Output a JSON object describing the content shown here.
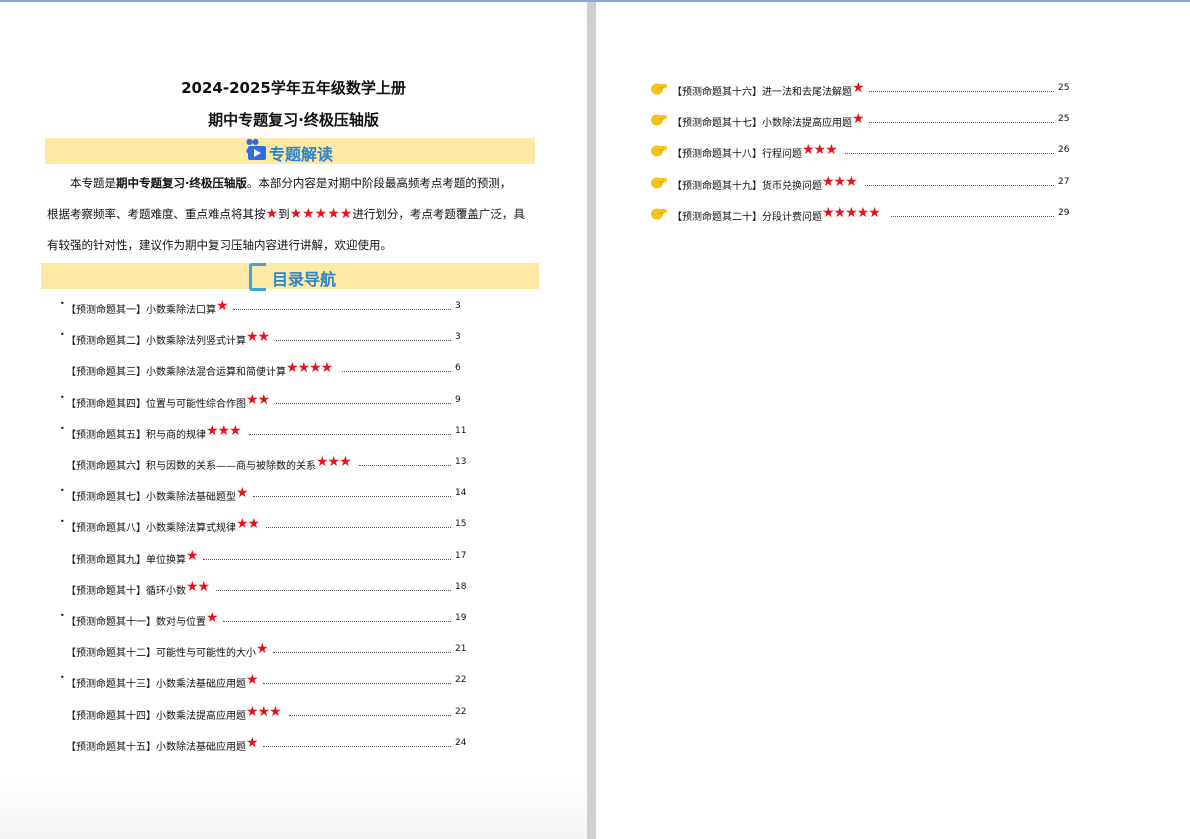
{
  "document": {
    "title_line1": "2024-2025学年五年级数学上册",
    "title_line2": "期中专题复习·终极压轴版",
    "section1_label": "专题解读",
    "section2_label": "目录导航",
    "intro": {
      "line1_pre": "本专题是",
      "line1_bold": "期中专题复习·终极压轴版",
      "line1_post": "。本部分内容是对期中阶段最高频考点考题的预测，",
      "line2_pre": "根据考察频率、考题难度、重点难点将其按",
      "line2_star1": "★",
      "line2_mid": "到",
      "line2_star5": "★★★★★",
      "line2_post": "进行划分，考点考题覆盖广泛，具",
      "line3": "有较强的针对性，建议作为期中复习压轴内容进行讲解，欢迎使用。"
    }
  },
  "toc_left": [
    {
      "label": "【预测命题其一】小数乘除法口算",
      "stars": "★",
      "page": "3"
    },
    {
      "label": "【预测命题其二】小数乘除法列竖式计算",
      "stars": "★★",
      "page": "3"
    },
    {
      "label": "【预测命题其三】小数乘除法混合运算和简便计算",
      "stars": "★★★★",
      "page": "6"
    },
    {
      "label": "【预测命题其四】位置与可能性综合作图",
      "stars": "★★",
      "page": "9"
    },
    {
      "label": "【预测命题其五】积与商的规律",
      "stars": "★★★",
      "page": "11"
    },
    {
      "label": "【预测命题其六】积与因数的关系——商与被除数的关系",
      "stars": "★★★",
      "page": "13"
    },
    {
      "label": "【预测命题其七】小数乘除法基础题型",
      "stars": "★",
      "page": "14"
    },
    {
      "label": "【预测命题其八】小数乘除法算式规律",
      "stars": "★★",
      "page": "15"
    },
    {
      "label": "【预测命题其九】单位换算",
      "stars": "★",
      "page": "17"
    },
    {
      "label": "【预测命题其十】循环小数",
      "stars": "★★",
      "page": "18"
    },
    {
      "label": "【预测命题其十一】数对与位置",
      "stars": "★",
      "page": "19"
    },
    {
      "label": "【预测命题其十二】可能性与可能性的大小",
      "stars": "★",
      "page": "21"
    },
    {
      "label": "【预测命题其十三】小数乘法基础应用题",
      "stars": "★",
      "page": "22"
    },
    {
      "label": "【预测命题其十四】小数乘法提高应用题",
      "stars": "★★★",
      "page": "22"
    },
    {
      "label": "【预测命题其十五】小数除法基础应用题",
      "stars": "★",
      "page": "24"
    }
  ],
  "toc_right": [
    {
      "label": "【预测命题其十六】进一法和去尾法解题",
      "stars": "★",
      "page": "25"
    },
    {
      "label": "【预测命题其十七】小数除法提高应用题",
      "stars": "★",
      "page": "25"
    },
    {
      "label": "【预测命题其十八】行程问题",
      "stars": "★★★",
      "page": "26"
    },
    {
      "label": "【预测命题其十九】货币兑换问题",
      "stars": "★★★",
      "page": "27"
    },
    {
      "label": "【预测命题其二十】分段计费问题",
      "stars": "★★★★★",
      "page": "29"
    }
  ],
  "colors": {
    "band": "#fde9a5",
    "heading": "#2c83c9",
    "star": "#e8121b"
  }
}
